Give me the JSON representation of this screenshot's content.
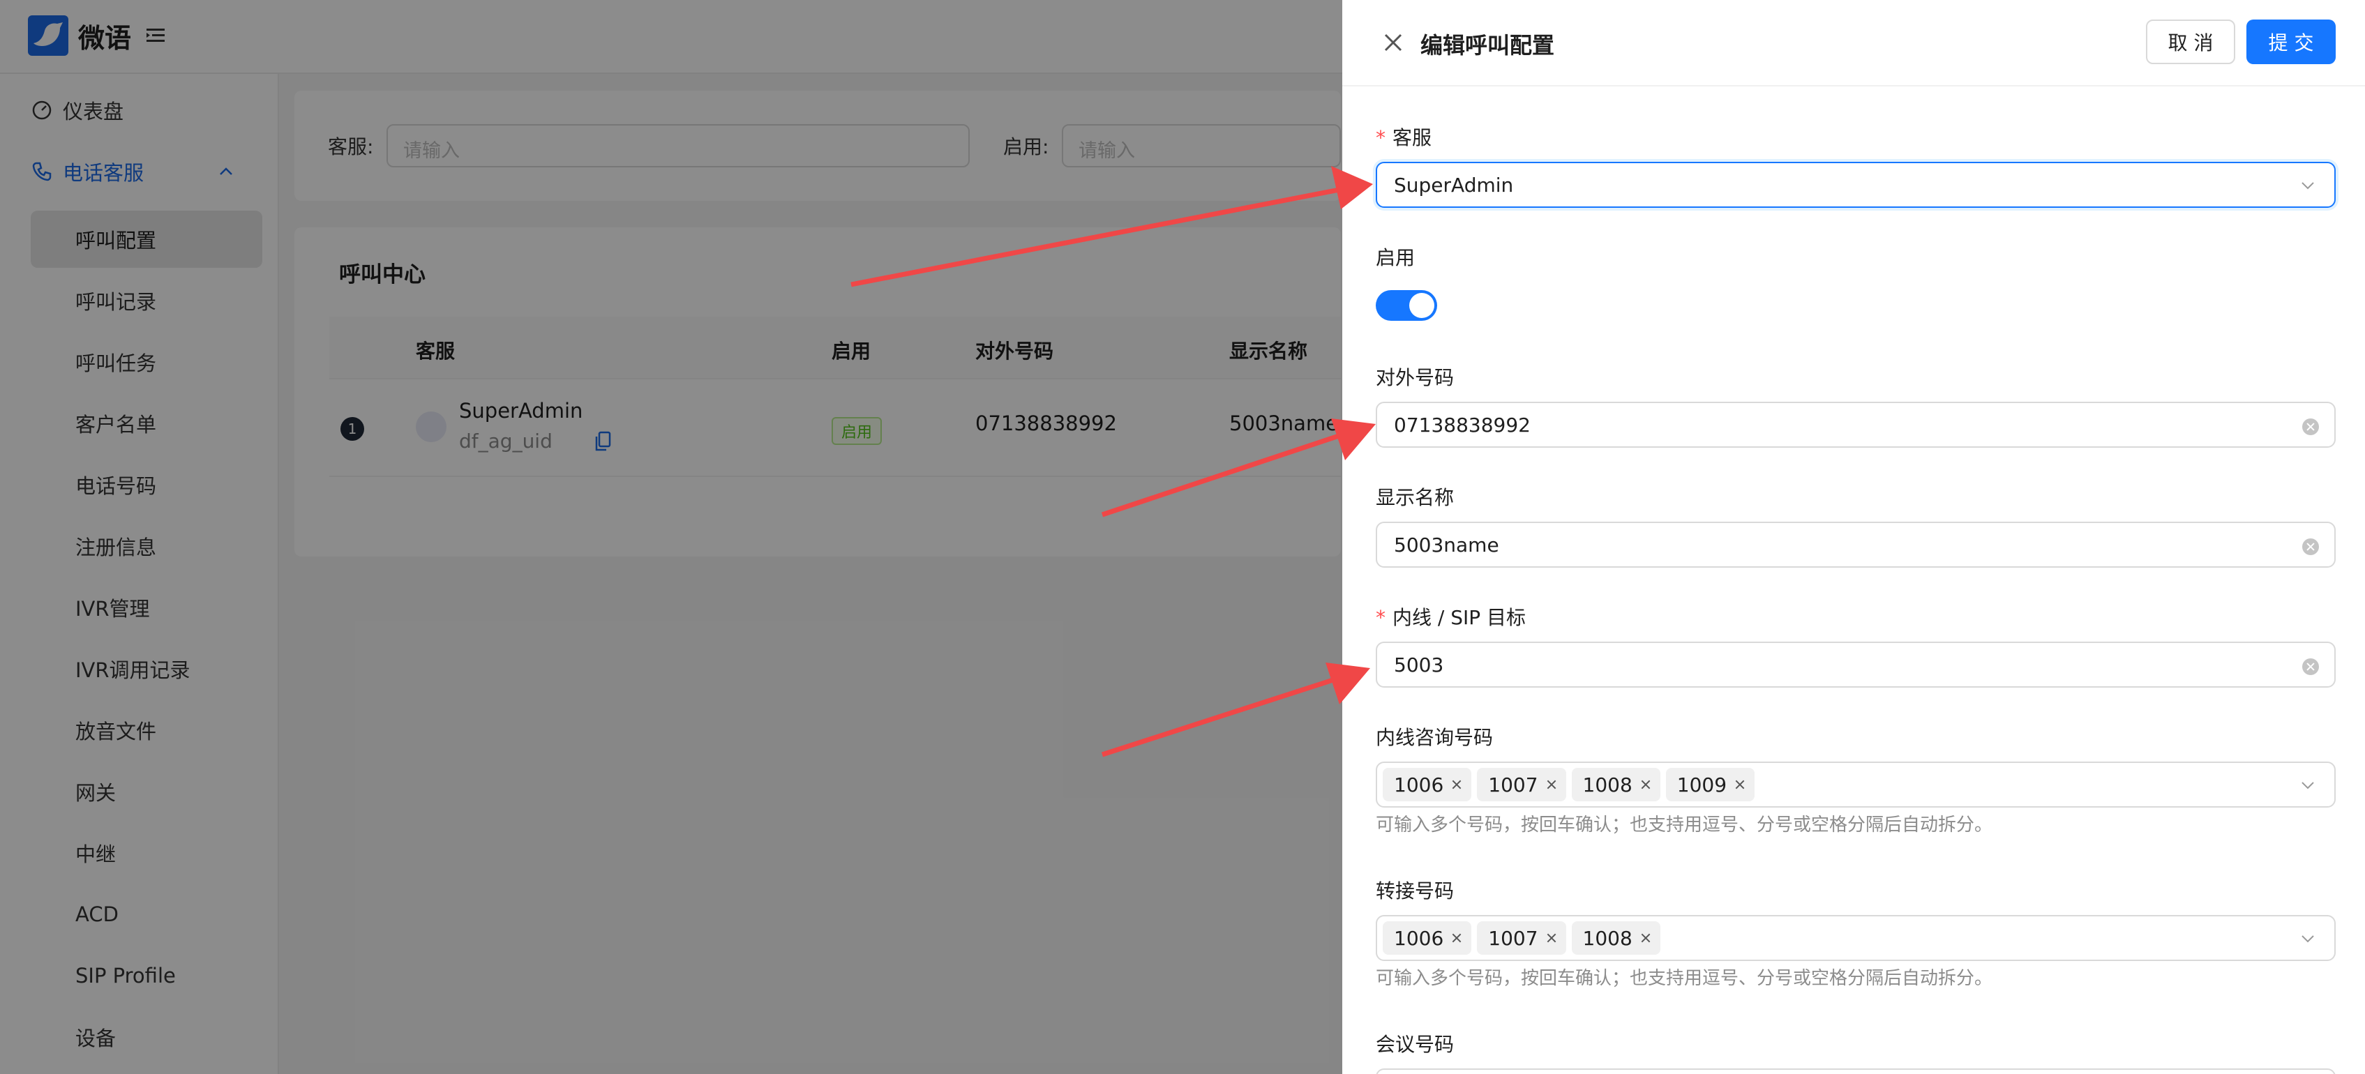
{
  "app": {
    "brand": "微语"
  },
  "sidebar": {
    "dashboard": "仪表盘",
    "phone_service": "电话客服",
    "items": [
      {
        "label": "呼叫配置",
        "selected": true
      },
      {
        "label": "呼叫记录"
      },
      {
        "label": "呼叫任务"
      },
      {
        "label": "客户名单"
      },
      {
        "label": "电话号码"
      },
      {
        "label": "注册信息"
      },
      {
        "label": "IVR管理"
      },
      {
        "label": "IVR调用记录"
      },
      {
        "label": "放音文件"
      },
      {
        "label": "网关"
      },
      {
        "label": "中继"
      },
      {
        "label": "ACD"
      },
      {
        "label": "SIP Profile"
      },
      {
        "label": "设备"
      }
    ]
  },
  "filters": {
    "agent_label": "客服:",
    "agent_placeholder": "请输入",
    "enabled_label": "启用:",
    "enabled_placeholder": "请输入"
  },
  "table": {
    "title": "呼叫中心",
    "columns": [
      "客服",
      "启用",
      "对外号码",
      "显示名称"
    ],
    "rows": [
      {
        "index": "1",
        "agent": "SuperAdmin",
        "uid": "df_ag_uid",
        "enabled": "启用",
        "outbound": "07138838992",
        "display_name": "5003name"
      }
    ]
  },
  "drawer": {
    "title": "编辑呼叫配置",
    "cancel": "取 消",
    "submit": "提 交",
    "fields": {
      "agent": {
        "label": "客服",
        "value": "SuperAdmin"
      },
      "enabled": {
        "label": "启用",
        "on": true
      },
      "outbound": {
        "label": "对外号码",
        "value": "07138838992"
      },
      "display_name": {
        "label": "显示名称",
        "value": "5003name"
      },
      "sip_target": {
        "label": "内线 / SIP 目标",
        "value": "5003"
      },
      "consult": {
        "label": "内线咨询号码",
        "tags": [
          "1006",
          "1007",
          "1008",
          "1009"
        ],
        "help": "可输入多个号码，按回车确认；也支持用逗号、分号或空格分隔后自动拆分。"
      },
      "transfer": {
        "label": "转接号码",
        "tags": [
          "1006",
          "1007",
          "1008"
        ],
        "help": "可输入多个号码，按回车确认；也支持用逗号、分号或空格分隔后自动拆分。"
      },
      "conference": {
        "label": "会议号码"
      }
    }
  },
  "colors": {
    "primary": "#1677ff",
    "annotation_arrow": "#f04747"
  }
}
